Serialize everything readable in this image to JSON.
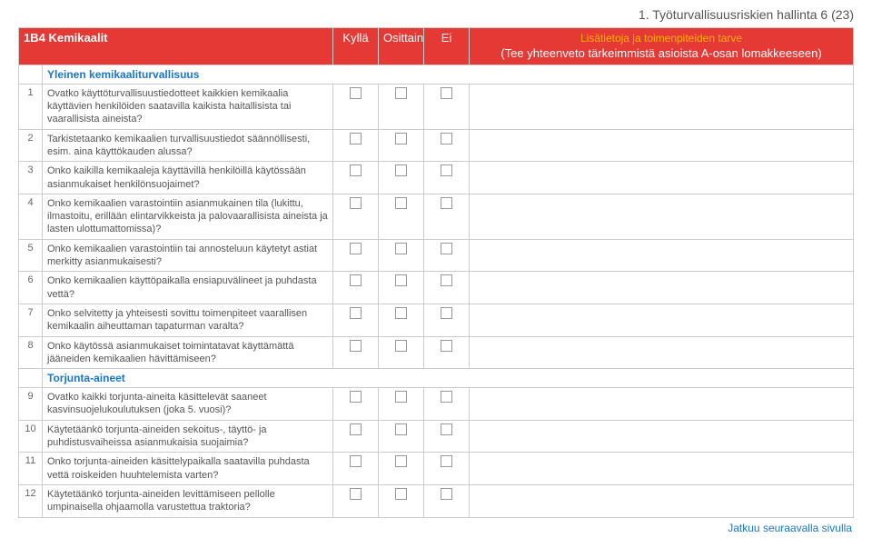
{
  "page_title": "1. Työturvallisuusriskien hallinta 6 (23)",
  "header": {
    "code": "1B4",
    "title": "Kemikaalit",
    "col_yes": "Kyllä",
    "col_partly": "Osittain",
    "col_no": "Ei",
    "note_line1": "Lisätietoja ja toimenpiteiden tarve",
    "note_line2": "(Tee yhteenveto tärkeimmistä asioista A-osan lomakkeeseen)"
  },
  "sections": [
    {
      "label": "Yleinen kemikaaliturvallisuus",
      "items": [
        {
          "n": "1",
          "q": "Ovatko käyttöturvallisuustiedotteet kaikkien kemikaalia käyttävien henkilöiden saatavilla kaikista haitallisista tai vaarallisista aineista?"
        },
        {
          "n": "2",
          "q": "Tarkistetaanko kemikaalien turvallisuustiedot säännöllisesti, esim. aina käyttökauden alussa?"
        },
        {
          "n": "3",
          "q": "Onko kaikilla kemikaaleja käyttävillä henkilöillä käytössään asianmukaiset henkilönsuojaimet?"
        },
        {
          "n": "4",
          "q": "Onko kemikaalien varastointiin asianmukainen tila (lukittu, ilmastoitu, erillään elintarvikkeista ja palovaarallisista aineista ja lasten ulottumattomissa)?"
        },
        {
          "n": "5",
          "q": "Onko kemikaalien varastointiin tai annosteluun käytetyt astiat merkitty asianmukaisesti?"
        },
        {
          "n": "6",
          "q": "Onko kemikaalien käyttöpaikalla ensiapuvälineet ja puhdasta vettä?"
        },
        {
          "n": "7",
          "q": "Onko selvitetty ja yhteisesti sovittu toimenpiteet vaarallisen kemikaalin aiheuttaman tapaturman varalta?"
        },
        {
          "n": "8",
          "q": "Onko käytössä asianmukaiset toimintatavat käyttämättä jääneiden kemikaalien hävittämiseen?"
        }
      ]
    },
    {
      "label": "Torjunta-aineet",
      "items": [
        {
          "n": "9",
          "q": "Ovatko kaikki torjunta-aineita käsittelevät saaneet kasvinsuojelukoulutuksen (joka 5. vuosi)?"
        },
        {
          "n": "10",
          "q": "Käytetäänkö torjunta-aineiden sekoitus-, täyttö- ja puhdistusvaiheissa asianmukaisia suojaimia?"
        },
        {
          "n": "11",
          "q": "Onko torjunta-aineiden käsittelypaikalla saatavilla puhdasta vettä roiskeiden huuhtelemista varten?"
        },
        {
          "n": "12",
          "q": "Käytetäänkö torjunta-aineiden levittämiseen pellolle umpinaisella ohjaamolla varustettua traktoria?"
        }
      ]
    }
  ],
  "footer": "Jatkuu seuraavalla sivulla"
}
